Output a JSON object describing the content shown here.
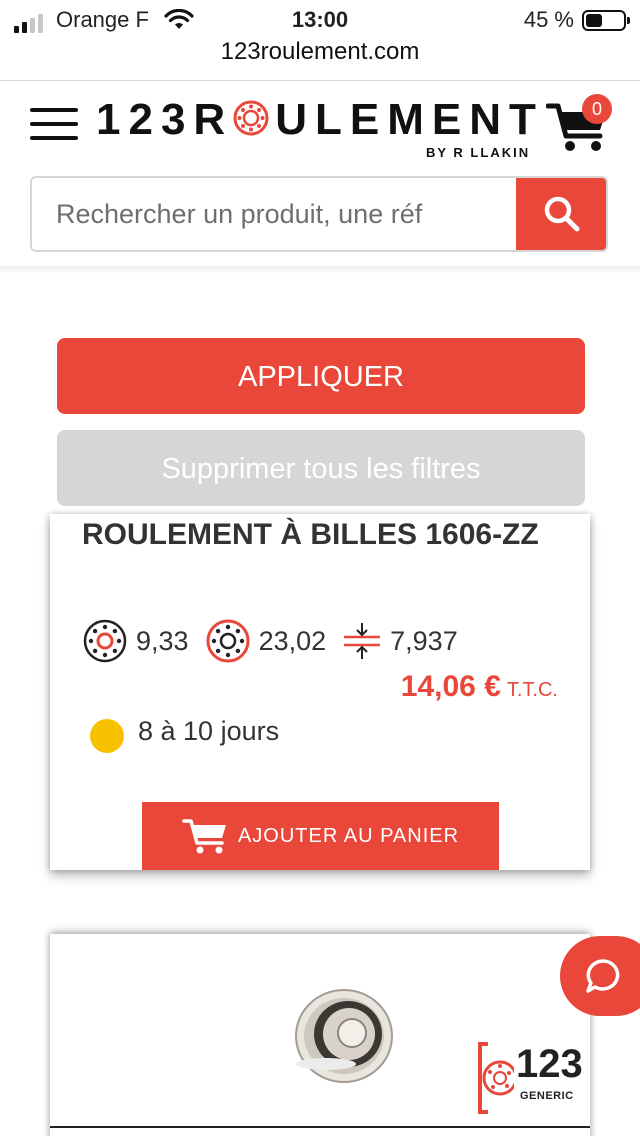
{
  "status_bar": {
    "carrier": "Orange F",
    "time": "13:00",
    "battery_percent": "45 %",
    "battery_level": 0.45
  },
  "browser": {
    "url": "123roulement.com"
  },
  "header": {
    "logo_text_before": "123R",
    "logo_text_after": "ULEMENT",
    "logo_subtitle": "BY R  LLAKIN",
    "cart_count": "0",
    "search_placeholder": "Rechercher un produit, une réf"
  },
  "filters": {
    "apply_label": "APPLIQUER",
    "clear_label": "Supprimer tous les filtres"
  },
  "product": {
    "title": "ROULEMENT À BILLES 1606-ZZ",
    "inner_diameter": "9,33",
    "outer_diameter": "23,02",
    "width": "7,937",
    "price": "14,06 €",
    "price_suffix": "T.T.C.",
    "availability": "8 à 10 jours",
    "availability_color": "#f8c100",
    "add_to_cart_label": "AJOUTER AU PANIER"
  },
  "product2": {
    "brand_number": "123",
    "brand_label": "GENERIC"
  },
  "colors": {
    "accent": "#e8473a",
    "disabled": "#d6d6d6"
  }
}
